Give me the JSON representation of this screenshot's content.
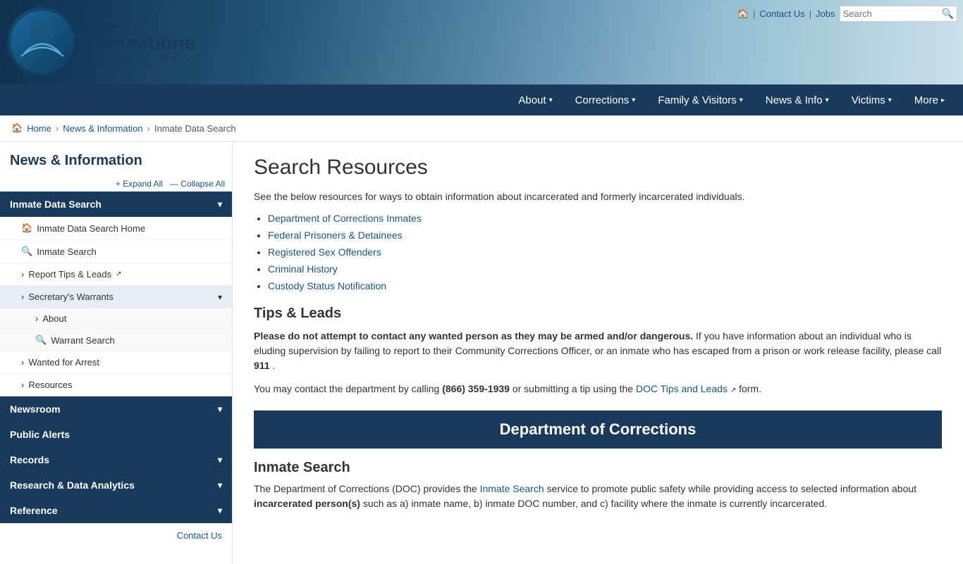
{
  "header": {
    "logo": {
      "dept": "Department of",
      "corrections": "Corrections",
      "state": "WASHINGTON STATE"
    },
    "utility": {
      "home_icon": "🏠",
      "contact_label": "Contact Us",
      "jobs_label": "Jobs",
      "search_placeholder": "Search"
    }
  },
  "navbar": {
    "items": [
      {
        "label": "About",
        "arrow": "▾"
      },
      {
        "label": "Corrections",
        "arrow": "▾"
      },
      {
        "label": "Family & Visitors",
        "arrow": "▾"
      },
      {
        "label": "News & Info",
        "arrow": "▾"
      },
      {
        "label": "Victims",
        "arrow": "▾"
      },
      {
        "label": "More",
        "arrow": "▸"
      }
    ]
  },
  "breadcrumb": {
    "home": "Home",
    "news": "News & Information",
    "current": "Inmate Data Search"
  },
  "sidebar": {
    "title": "News & Information",
    "expand_label": "+ Expand All",
    "collapse_label": "— Collapse All",
    "sections": [
      {
        "id": "inmate-data-search",
        "label": "Inmate Data Search",
        "active": true,
        "items": [
          {
            "id": "inmate-data-search-home",
            "icon": "home",
            "label": "Inmate Data Search Home"
          },
          {
            "id": "inmate-search",
            "icon": "search",
            "label": "Inmate Search"
          },
          {
            "id": "report-tips",
            "icon": "arrow",
            "label": "Report Tips & Leads",
            "ext": true
          },
          {
            "id": "secretarys-warrants",
            "icon": "arrow",
            "label": "Secretary's Warrants",
            "expanded": true,
            "subitems": [
              {
                "id": "about",
                "icon": "arrow",
                "label": "About"
              },
              {
                "id": "warrant-search",
                "icon": "search",
                "label": "Warrant Search"
              }
            ]
          },
          {
            "id": "wanted-for-arrest",
            "icon": "arrow",
            "label": "Wanted for Arrest"
          },
          {
            "id": "resources",
            "icon": "arrow",
            "label": "Resources"
          }
        ]
      },
      {
        "id": "newsroom",
        "label": "Newsroom",
        "active": false
      },
      {
        "id": "public-alerts",
        "label": "Public Alerts",
        "active": false
      },
      {
        "id": "records",
        "label": "Records",
        "active": false
      },
      {
        "id": "research-data",
        "label": "Research & Data Analytics",
        "active": false
      },
      {
        "id": "reference",
        "label": "Reference",
        "active": false
      }
    ],
    "contact_label": "Contact Us"
  },
  "content": {
    "title": "Search Resources",
    "intro": "See the below resources for ways to obtain information about incarcerated and formerly incarcerated individuals.",
    "links": [
      {
        "label": "Department of Corrections Inmates"
      },
      {
        "label": "Federal Prisoners & Detainees"
      },
      {
        "label": "Registered Sex Offenders"
      },
      {
        "label": "Criminal History"
      },
      {
        "label": "Custody Status Notification"
      }
    ],
    "tips_title": "Tips & Leads",
    "tips_bold": "Please do not attempt to contact any wanted person as they may be armed and/or dangerous.",
    "tips_text": " If you have information about an individual who is eluding supervision by failing to report to their Community Corrections Officer, or an inmate who has escaped from a prison or work release facility, please call ",
    "tips_call": "911",
    "tips_end": ".",
    "tips_contact_pre": "You may contact the department by calling ",
    "tips_phone": "(866) 359-1939",
    "tips_contact_mid": " or submitting a tip using the ",
    "tips_link": "DOC Tips and Leads",
    "tips_contact_end": " form.",
    "doc_header": "Department of Corrections",
    "inmate_search_title": "Inmate Search",
    "inmate_search_text_pre": "The Department of Corrections (DOC) provides the ",
    "inmate_search_link": "Inmate Search",
    "inmate_search_text_mid": " service to promote public safety while providing access to selected information about ",
    "inmate_search_bold": "incarcerated person(s)",
    "inmate_search_text_end": " such as a) inmate name, b) inmate DOC number, and c) facility where the inmate is currently incarcerated."
  }
}
